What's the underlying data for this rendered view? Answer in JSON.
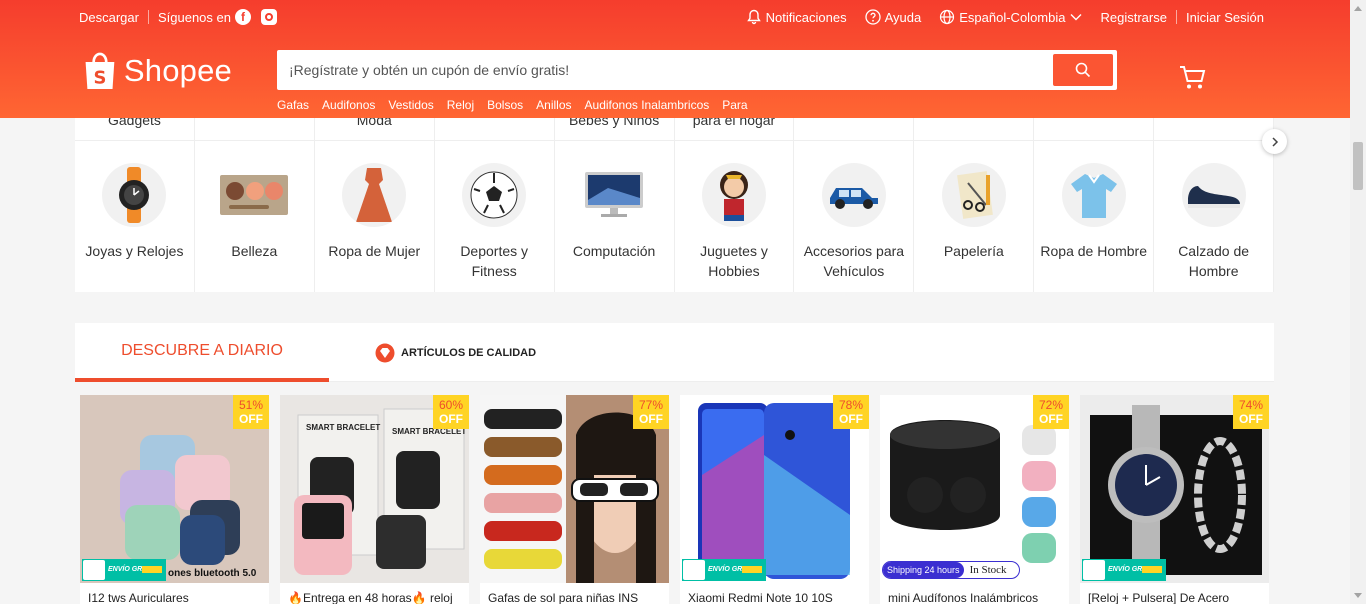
{
  "topbar": {
    "download": "Descargar",
    "follow": "Síguenos en",
    "notifications": "Notificaciones",
    "help": "Ayuda",
    "language": "Español-Colombia",
    "register": "Registrarse",
    "login": "Iniciar Sesión"
  },
  "logo": {
    "text": "Shopee"
  },
  "search": {
    "placeholder": "¡Regístrate y obtén un cupón de envío gratis!"
  },
  "suggestions": [
    "Gafas",
    "Audifonos",
    "Vestidos",
    "Reloj",
    "Bolsos",
    "Anillos",
    "Audifonos Inalambricos",
    "Para"
  ],
  "categories_top": [
    "Gadgets",
    "",
    "Moda",
    "",
    "Bebés y Niños",
    "para el hogar",
    "",
    "",
    "",
    ""
  ],
  "categories": [
    {
      "label": "Joyas y Relojes",
      "icon": "watch-icon"
    },
    {
      "label": "Belleza",
      "icon": "palette-icon"
    },
    {
      "label": "Ropa de Mujer",
      "icon": "dress-icon"
    },
    {
      "label": "Deportes y Fitness",
      "icon": "soccer-ball-icon"
    },
    {
      "label": "Computación",
      "icon": "computer-icon"
    },
    {
      "label": "Juguetes y Hobbies",
      "icon": "figure-icon"
    },
    {
      "label": "Accesorios para Vehículos",
      "icon": "car-icon"
    },
    {
      "label": "Papelería",
      "icon": "stationery-icon"
    },
    {
      "label": "Ropa de Hombre",
      "icon": "shirt-icon"
    },
    {
      "label": "Calzado de Hombre",
      "icon": "shoe-icon"
    }
  ],
  "tabs": {
    "discover": "DESCUBRE A DIARIO",
    "quality": "ARTÍCULOS DE CALIDAD"
  },
  "products": [
    {
      "name": "I12 tws Auriculares",
      "discount": "51%",
      "off": "OFF"
    },
    {
      "name": "🔥Entrega en 48 horas🔥 reloj",
      "discount": "60%",
      "off": "OFF"
    },
    {
      "name": "Gafas de sol para niñas INS",
      "discount": "77%",
      "off": "OFF"
    },
    {
      "name": "Xiaomi Redmi Note 10 10S",
      "discount": "78%",
      "off": "OFF"
    },
    {
      "name": "mini Audífonos Inalámbricos",
      "discount": "72%",
      "off": "OFF"
    },
    {
      "name": "[Reloj + Pulsera] De Acero",
      "discount": "74%",
      "off": "OFF"
    }
  ],
  "image_text": {
    "bracelet": "SMART BRACELET",
    "earbuds": "ones bluetooth 5.0",
    "shipping24": "Shipping 24 hours",
    "instock": "In Stock",
    "envio": "ENVÍO GRATIS"
  },
  "colors": {
    "brand": "#ee4d2d",
    "header_top": "#f53d2d",
    "header_bottom": "#ff6633",
    "badge": "#ffd424"
  }
}
